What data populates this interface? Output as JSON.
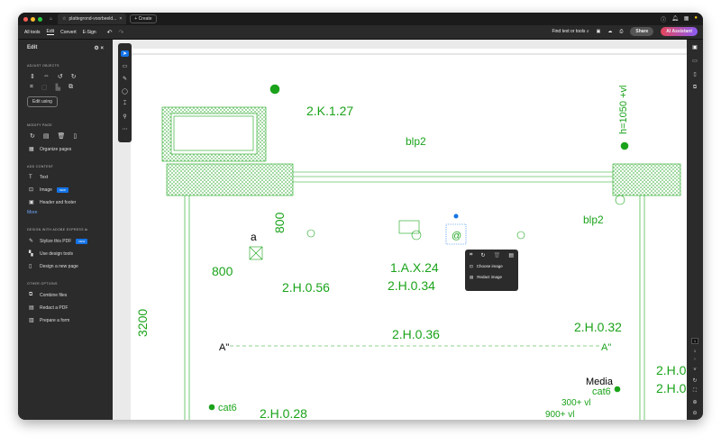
{
  "window": {
    "tab_title": "plattegrond-voorbeeld...",
    "new_tab": "Create"
  },
  "toolbar": {
    "menu": [
      "All tools",
      "Edit",
      "Convert",
      "E-Sign"
    ],
    "search": "Find text or tools",
    "share": "Share",
    "ai": "AI Assistant"
  },
  "panel": {
    "title": "Edit",
    "adjust_objects": "ADJUST OBJECTS",
    "edit_using": "Edit using",
    "modify_page": "MODIFY PAGE",
    "organize": "Organize pages",
    "add_content": "ADD CONTENT",
    "text": "Text",
    "image": "Image",
    "new": "NEW",
    "header_footer": "Header and footer",
    "more": "More",
    "design": "DESIGN WITH ADOBE EXPRESS",
    "stylize": "Stylize this PDF",
    "design_tools": "Use design tools",
    "new_page": "Design a new page",
    "other": "OTHER OPTIONS",
    "combine": "Combine files",
    "redact": "Redact a PDF",
    "form": "Prepare a form"
  },
  "context_menu": {
    "choose": "Choose image",
    "redact": "Redact image"
  },
  "page_nav": {
    "current": "1",
    "total": "1"
  },
  "plan_labels": {
    "l1": "2.K.1.27",
    "l2": "blp2",
    "l3": "h=1050 +vl",
    "l4": "800",
    "l5": "a",
    "l6": "blp2",
    "l7": "800",
    "l8": "1.A.X.24",
    "l9": "2.H.0.34",
    "l10": "2.H.0.56",
    "l11": "3200",
    "l12": "2.H.0.36",
    "l13": "2.H.0.32",
    "l14": "A\"",
    "l15": "A\"",
    "l16": "Media",
    "l17": "cat6",
    "l18": "300+ vl",
    "l19": "2.H.0",
    "l20": "2.H.0",
    "l21": "cat6",
    "l22": "2.H.0.28",
    "l23": "900+ vl",
    "l24": "@"
  },
  "colors": {
    "plan": "#1aa31a",
    "accent": "#1473e6"
  }
}
